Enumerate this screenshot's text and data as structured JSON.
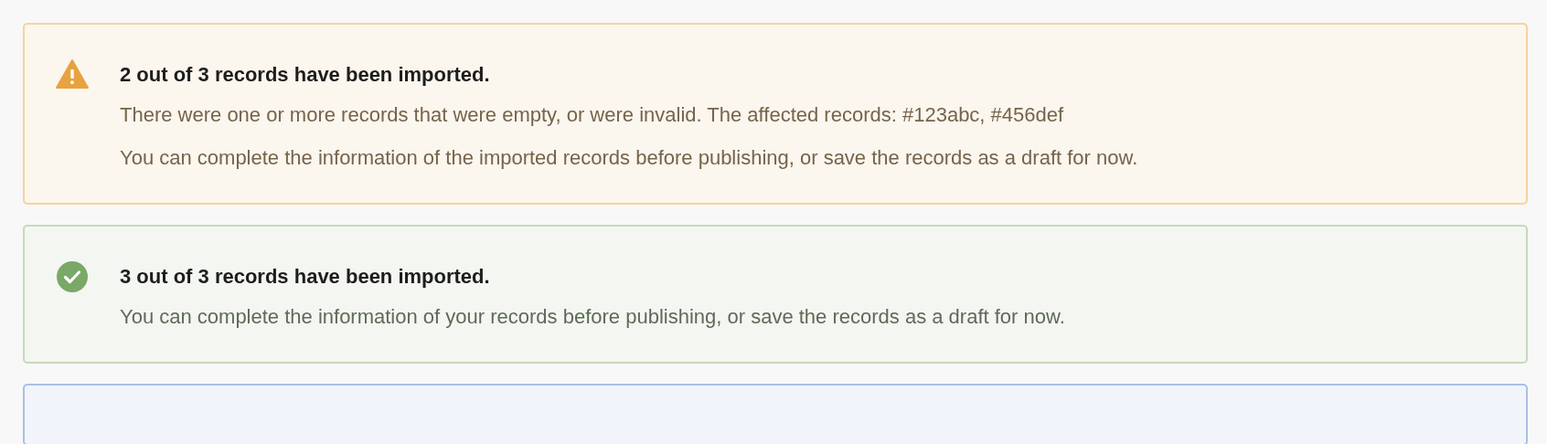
{
  "alerts": [
    {
      "kind": "warning",
      "title": "2 out of 3 records have been imported.",
      "lines": [
        "There were one or more records that were empty, or were invalid. The affected records: #123abc, #456def",
        "You can complete the information of the imported records before publishing, or save the records as a draft for now."
      ]
    },
    {
      "kind": "success",
      "title": "3 out of 3 records have been imported.",
      "lines": [
        "You can complete the information of your records before publishing, or save the records as a draft for now."
      ]
    },
    {
      "kind": "info"
    }
  ]
}
